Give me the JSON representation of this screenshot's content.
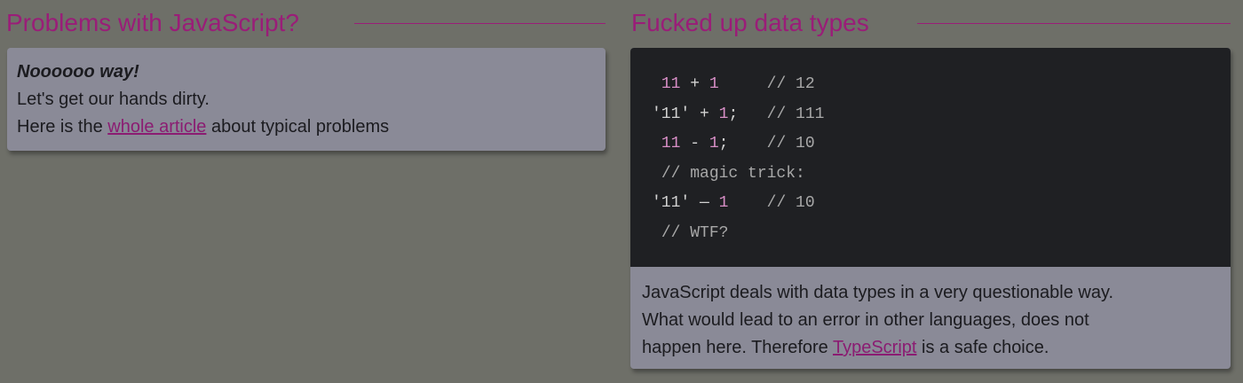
{
  "left_section": {
    "title": "Problems with JavaScript?",
    "card": {
      "emphasis": "Noooooo way!",
      "line2": "Let's get our hands dirty.",
      "line3_before": "Here is the ",
      "line3_link": "whole article",
      "line3_after": " about typical problems"
    }
  },
  "right_section": {
    "title": "Fucked up data types",
    "code": [
      {
        "parts": [
          " ",
          {
            "t": "11",
            "c": "num"
          },
          " + ",
          {
            "t": "1",
            "c": "num"
          },
          "     ",
          {
            "t": "// 12",
            "c": "comment"
          }
        ]
      },
      {
        "parts": [
          "'11' + ",
          {
            "t": "1",
            "c": "num"
          },
          ";   ",
          {
            "t": "// 111",
            "c": "comment"
          }
        ]
      },
      {
        "parts": [
          " ",
          {
            "t": "11",
            "c": "num"
          },
          " - ",
          {
            "t": "1",
            "c": "num"
          },
          ";    ",
          {
            "t": "// 10",
            "c": "comment"
          }
        ]
      },
      {
        "parts": [
          " ",
          {
            "t": "// magic trick:",
            "c": "comment"
          }
        ]
      },
      {
        "parts": [
          "'11' — ",
          {
            "t": "1",
            "c": "num"
          },
          "    ",
          {
            "t": "// 10",
            "c": "comment"
          }
        ]
      },
      {
        "parts": [
          " ",
          {
            "t": "// WTF?",
            "c": "comment"
          }
        ]
      }
    ],
    "description": {
      "line1": "JavaScript deals with data types in a very questionable way.",
      "line2": "What would lead to an error in other languages, does not",
      "line3_before": "happen here. Therefore ",
      "line3_link": "TypeScript",
      "line3_after": "  is a safe choice."
    }
  },
  "colors": {
    "background": "#6e6f68",
    "accent": "#9a1d78",
    "card": "#8a8a97",
    "code_background": "#1f2023",
    "code_number": "#d98fc7",
    "code_comment": "#a8a8a8"
  }
}
